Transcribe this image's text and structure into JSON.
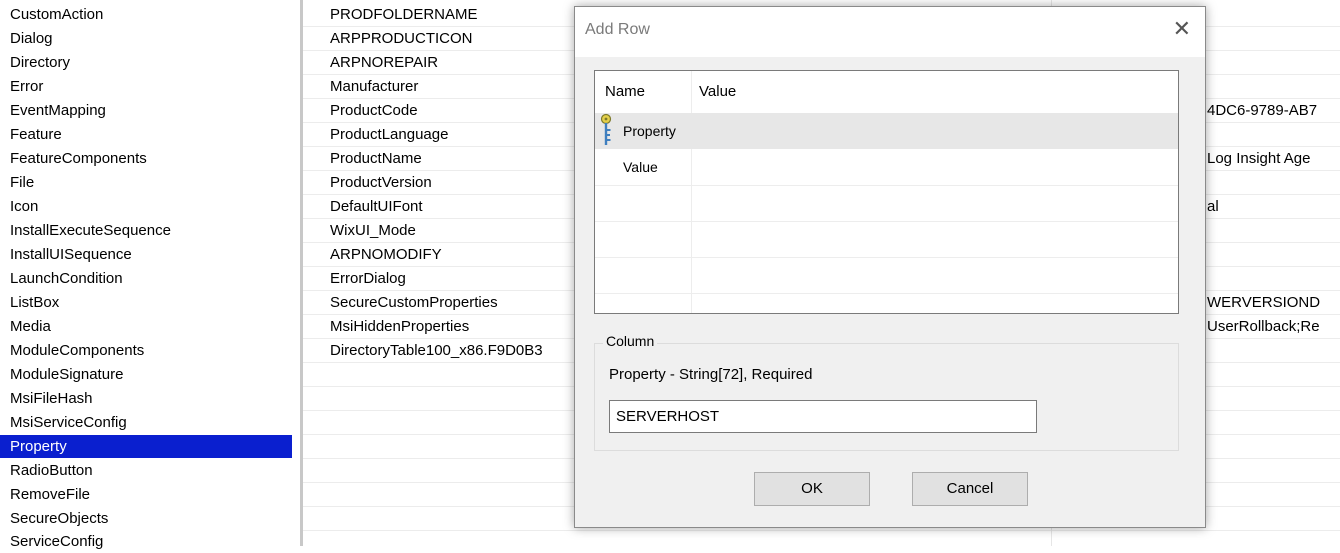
{
  "tables": {
    "items": [
      {
        "label": "CustomAction"
      },
      {
        "label": "Dialog"
      },
      {
        "label": "Directory"
      },
      {
        "label": "Error"
      },
      {
        "label": "EventMapping"
      },
      {
        "label": "Feature"
      },
      {
        "label": "FeatureComponents"
      },
      {
        "label": "File"
      },
      {
        "label": "Icon"
      },
      {
        "label": "InstallExecuteSequence"
      },
      {
        "label": "InstallUISequence"
      },
      {
        "label": "LaunchCondition"
      },
      {
        "label": "ListBox"
      },
      {
        "label": "Media"
      },
      {
        "label": "ModuleComponents"
      },
      {
        "label": "ModuleSignature"
      },
      {
        "label": "MsiFileHash"
      },
      {
        "label": "MsiServiceConfig"
      },
      {
        "label": "Property",
        "selected": true
      },
      {
        "label": "RadioButton"
      },
      {
        "label": "RemoveFile"
      },
      {
        "label": "SecureObjects"
      },
      {
        "label": "ServiceConfig"
      }
    ]
  },
  "grid": {
    "rows": [
      {
        "property": "PRODFOLDERNAME",
        "value": ""
      },
      {
        "property": "ARPPRODUCTICON",
        "value": ""
      },
      {
        "property": "ARPNOREPAIR",
        "value": ""
      },
      {
        "property": "Manufacturer",
        "value": ""
      },
      {
        "property": "ProductCode",
        "value": "4DC6-9789-AB7"
      },
      {
        "property": "ProductLanguage",
        "value": ""
      },
      {
        "property": "ProductName",
        "value": "Log Insight Age"
      },
      {
        "property": "ProductVersion",
        "value": ""
      },
      {
        "property": "DefaultUIFont",
        "value": "al"
      },
      {
        "property": "WixUI_Mode",
        "value": ""
      },
      {
        "property": "ARPNOMODIFY",
        "value": ""
      },
      {
        "property": "ErrorDialog",
        "value": ""
      },
      {
        "property": "SecureCustomProperties",
        "value": "WERVERSIOND"
      },
      {
        "property": "MsiHiddenProperties",
        "value": "UserRollback;Re"
      },
      {
        "property": "DirectoryTable100_x86.F9D0B3",
        "value": ""
      }
    ]
  },
  "dialog": {
    "title": "Add Row",
    "close_glyph": "✕",
    "list": {
      "headers": {
        "name": "Name",
        "value": "Value"
      },
      "rows": [
        {
          "name": "Property",
          "selected": true,
          "icon": "key-icon"
        },
        {
          "name": "Value",
          "selected": false
        }
      ]
    },
    "column": {
      "legend": "Column",
      "description": "Property - String[72], Required",
      "input_value": "SERVERHOST"
    },
    "buttons": {
      "ok": "OK",
      "cancel": "Cancel"
    }
  },
  "colors": {
    "selection": "#0a1fcf",
    "dialog_bg": "#f0f0f0",
    "row_highlight": "#e7e7e7"
  }
}
